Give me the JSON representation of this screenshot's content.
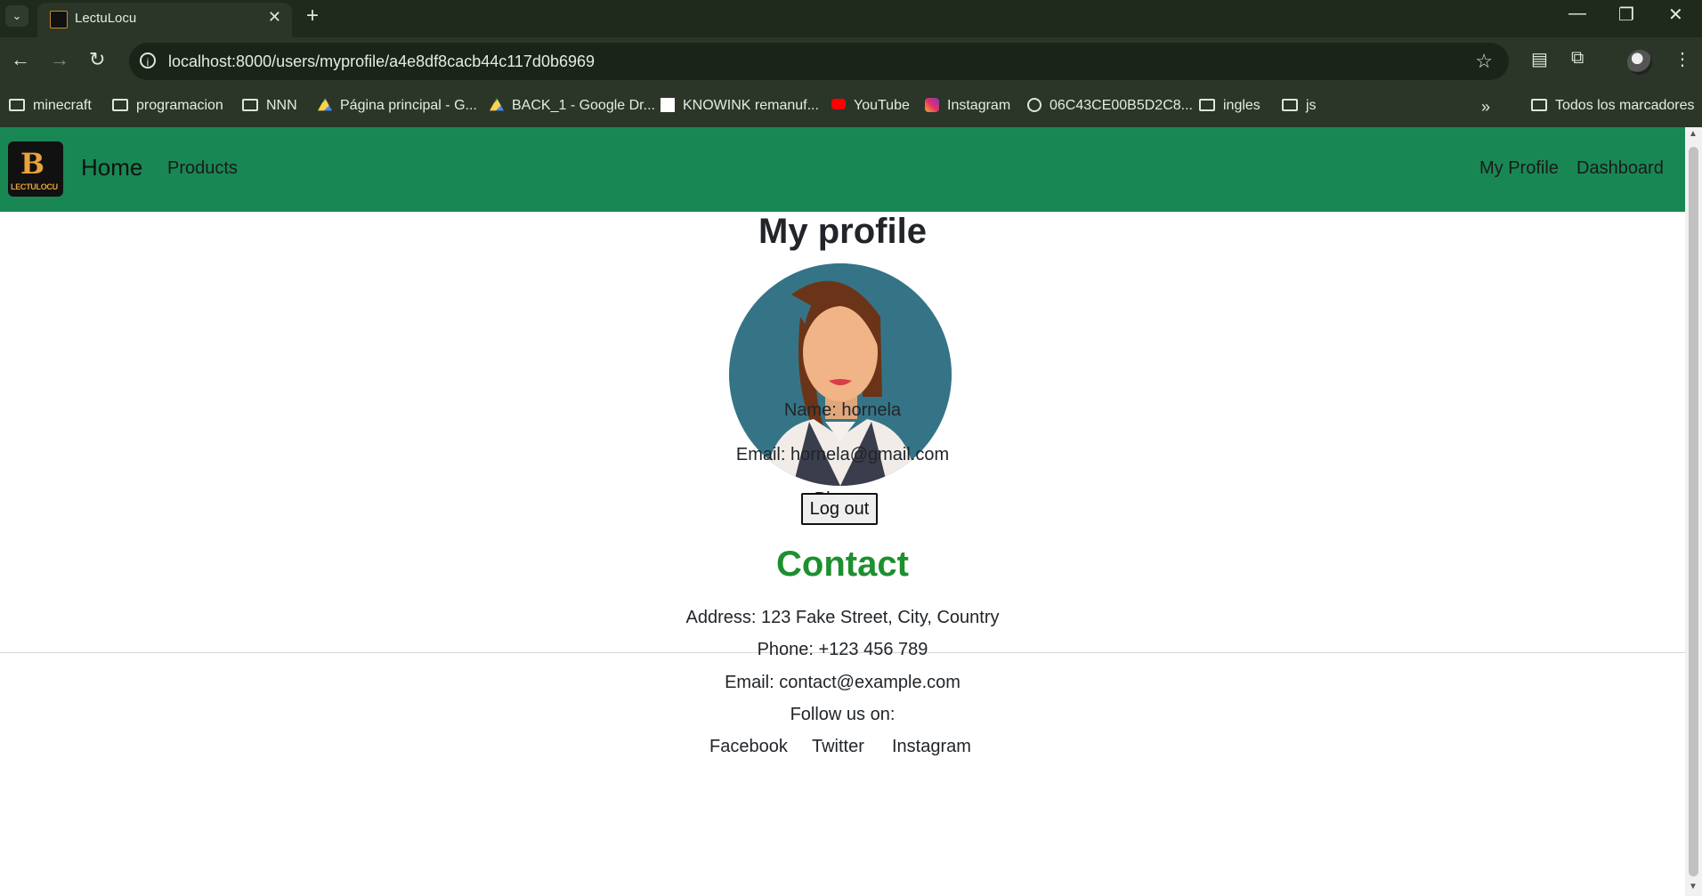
{
  "browser": {
    "tab_title": "LectuLocu",
    "url": "localhost:8000/users/myprofile/a4e8df8cacb44c117d0b6969",
    "bookmarks": [
      "minecraft",
      "programacion",
      "NNN",
      "Página principal - G...",
      "BACK_1 - Google Dr...",
      "KNOWINK remanuf...",
      "YouTube",
      "Instagram",
      "06C43CE00B5D2C8...",
      "ingles",
      "js"
    ],
    "all_bookmarks": "Todos los marcadores"
  },
  "navbar": {
    "logo_text": "LECTULOCU",
    "brand": "Home",
    "links": [
      "Products"
    ],
    "right_links": [
      "My Profile",
      "Dashboard"
    ],
    "color": "#198754"
  },
  "profile": {
    "title": "My profile",
    "name": "Name: hornela",
    "email": "Email: hornela@gmail.com",
    "phone": "Phone:",
    "logout_label": "Log out"
  },
  "contact": {
    "title": "Contact",
    "address": "Address: 123 Fake Street, City, Country",
    "phone": "Phone: +123 456 789",
    "email": "Email: contact@example.com",
    "follow": "Follow us on:",
    "social": [
      "Facebook",
      "Twitter",
      "Instagram"
    ],
    "title_color": "#1d8f2f"
  }
}
